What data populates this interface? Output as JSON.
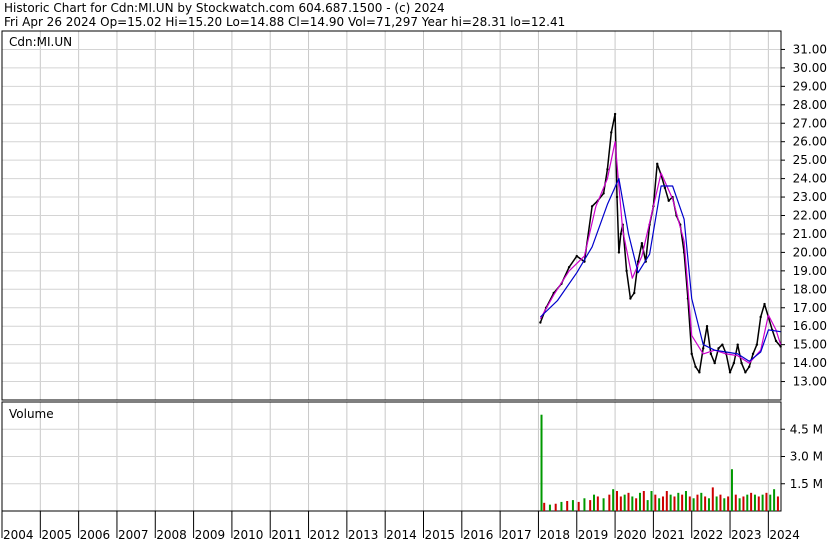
{
  "header": {
    "line1": "Historic Chart for Cdn:MI.UN by Stockwatch.com 604.687.1500 - (c) 2024",
    "line2": "Fri Apr 26 2024   Op=15.02   Hi=15.20   Lo=14.88   Cl=14.90   Vol=71,297   Year hi=28.31   lo=12.41"
  },
  "chart_data": [
    {
      "type": "line",
      "title": "Cdn:MI.UN",
      "ylim": [
        12,
        32
      ],
      "yticks": [
        "13.00",
        "14.00",
        "15.00",
        "16.00",
        "17.00",
        "18.00",
        "19.00",
        "20.00",
        "21.00",
        "22.00",
        "23.00",
        "24.00",
        "25.00",
        "26.00",
        "27.00",
        "28.00",
        "29.00",
        "30.00",
        "31.00"
      ],
      "xticks": [
        "2004",
        "2005",
        "2006",
        "2007",
        "2008",
        "2009",
        "2010",
        "2011",
        "2012",
        "2013",
        "2014",
        "2015",
        "2016",
        "2017",
        "2018",
        "2019",
        "2020",
        "2021",
        "2022",
        "2023",
        "2024"
      ],
      "series": [
        {
          "color": "#000000",
          "x": [
            2018.05,
            2018.2,
            2018.4,
            2018.6,
            2018.8,
            2019.0,
            2019.2,
            2019.4,
            2019.55,
            2019.7,
            2019.8,
            2019.9,
            2020.0,
            2020.05,
            2020.1,
            2020.15,
            2020.2,
            2020.3,
            2020.4,
            2020.5,
            2020.6,
            2020.7,
            2020.8,
            2020.9,
            2021.0,
            2021.1,
            2021.2,
            2021.3,
            2021.4,
            2021.5,
            2021.6,
            2021.7,
            2021.8,
            2021.9,
            2022.0,
            2022.1,
            2022.2,
            2022.3,
            2022.4,
            2022.5,
            2022.6,
            2022.7,
            2022.8,
            2022.9,
            2023.0,
            2023.1,
            2023.2,
            2023.3,
            2023.4,
            2023.5,
            2023.6,
            2023.7,
            2023.8,
            2023.9,
            2024.0,
            2024.1,
            2024.2,
            2024.32
          ],
          "values": [
            16.2,
            17.0,
            17.8,
            18.3,
            19.2,
            19.8,
            19.5,
            22.5,
            22.8,
            23.2,
            24.5,
            26.5,
            27.5,
            23.0,
            20.0,
            21.0,
            21.5,
            19.0,
            17.5,
            17.8,
            19.5,
            20.5,
            19.5,
            21.5,
            22.5,
            24.8,
            24.2,
            23.5,
            22.8,
            23.0,
            22.0,
            21.5,
            20.0,
            17.5,
            14.5,
            13.8,
            13.5,
            14.8,
            16.0,
            14.5,
            14.0,
            14.8,
            15.0,
            14.5,
            13.5,
            14.0,
            15.0,
            14.0,
            13.5,
            13.8,
            14.5,
            15.0,
            16.5,
            17.2,
            16.5,
            15.8,
            15.2,
            14.9
          ]
        },
        {
          "color": "#cc00cc",
          "x": [
            2018.05,
            2018.4,
            2018.8,
            2019.2,
            2019.5,
            2019.8,
            2020.0,
            2020.2,
            2020.45,
            2020.7,
            2021.0,
            2021.2,
            2021.5,
            2021.8,
            2022.0,
            2022.3,
            2022.6,
            2022.9,
            2023.2,
            2023.5,
            2023.8,
            2024.0,
            2024.2,
            2024.32
          ],
          "values": [
            16.4,
            17.7,
            19.0,
            19.8,
            22.5,
            24.0,
            26.0,
            21.2,
            18.6,
            19.8,
            22.5,
            24.3,
            22.9,
            20.6,
            15.5,
            14.5,
            14.7,
            14.5,
            14.4,
            14.0,
            14.7,
            16.6,
            15.8,
            15.0
          ]
        },
        {
          "color": "#0000cc",
          "x": [
            2018.05,
            2018.5,
            2019.0,
            2019.4,
            2019.8,
            2020.1,
            2020.35,
            2020.6,
            2020.9,
            2021.2,
            2021.5,
            2021.8,
            2022.0,
            2022.3,
            2022.6,
            2022.9,
            2023.2,
            2023.5,
            2023.8,
            2024.0,
            2024.32
          ],
          "values": [
            16.5,
            17.4,
            18.9,
            20.3,
            22.6,
            24.0,
            21.0,
            18.9,
            19.9,
            23.6,
            23.6,
            21.8,
            17.5,
            15.0,
            14.7,
            14.6,
            14.5,
            14.1,
            14.6,
            15.8,
            15.7
          ]
        }
      ]
    },
    {
      "type": "bar",
      "title": "Volume",
      "ylim": [
        0,
        6
      ],
      "yticks": [
        "1.5 M",
        "3.0 M",
        "4.5 M"
      ],
      "series": [
        {
          "name": "Volume",
          "x": [
            2018.08,
            2018.15,
            2018.3,
            2018.45,
            2018.6,
            2018.75,
            2018.9,
            2019.05,
            2019.2,
            2019.35,
            2019.45,
            2019.55,
            2019.7,
            2019.85,
            2019.95,
            2020.05,
            2020.15,
            2020.25,
            2020.35,
            2020.45,
            2020.55,
            2020.65,
            2020.75,
            2020.85,
            2020.95,
            2021.05,
            2021.15,
            2021.25,
            2021.35,
            2021.45,
            2021.55,
            2021.65,
            2021.75,
            2021.85,
            2021.95,
            2022.05,
            2022.15,
            2022.25,
            2022.35,
            2022.45,
            2022.55,
            2022.65,
            2022.75,
            2022.85,
            2022.95,
            2023.05,
            2023.15,
            2023.25,
            2023.35,
            2023.45,
            2023.55,
            2023.65,
            2023.75,
            2023.85,
            2023.95,
            2024.05,
            2024.15,
            2024.25
          ],
          "values": [
            5.3,
            0.45,
            0.35,
            0.4,
            0.5,
            0.55,
            0.6,
            0.5,
            0.7,
            0.6,
            0.9,
            0.8,
            0.7,
            0.9,
            1.2,
            1.1,
            0.8,
            0.9,
            1.0,
            0.8,
            0.7,
            1.0,
            1.1,
            0.6,
            1.1,
            0.9,
            0.7,
            0.8,
            1.1,
            0.9,
            0.8,
            1.0,
            0.9,
            1.1,
            0.8,
            0.7,
            0.9,
            1.0,
            0.8,
            0.7,
            1.3,
            0.8,
            0.9,
            0.7,
            0.8,
            2.3,
            0.9,
            0.7,
            0.8,
            0.9,
            1.0,
            0.9,
            0.8,
            0.9,
            1.0,
            0.9,
            1.2,
            0.8
          ],
          "colors": [
            "#009900",
            "#cc0000",
            "#009900",
            "#cc0000",
            "#009900",
            "#cc0000",
            "#009900",
            "#cc0000",
            "#009900",
            "#cc0000",
            "#009900",
            "#cc0000",
            "#009900",
            "#cc0000",
            "#009900",
            "#cc0000",
            "#cc0000",
            "#009900",
            "#cc0000",
            "#009900",
            "#cc0000",
            "#009900",
            "#cc0000",
            "#009900",
            "#009900",
            "#cc0000",
            "#009900",
            "#cc0000",
            "#cc0000",
            "#009900",
            "#cc0000",
            "#009900",
            "#cc0000",
            "#009900",
            "#cc0000",
            "#009900",
            "#cc0000",
            "#009900",
            "#cc0000",
            "#009900",
            "#cc0000",
            "#009900",
            "#cc0000",
            "#009900",
            "#cc0000",
            "#009900",
            "#cc0000",
            "#009900",
            "#cc0000",
            "#009900",
            "#cc0000",
            "#009900",
            "#cc0000",
            "#009900",
            "#cc0000",
            "#009900",
            "#009900",
            "#cc0000"
          ]
        }
      ]
    }
  ]
}
